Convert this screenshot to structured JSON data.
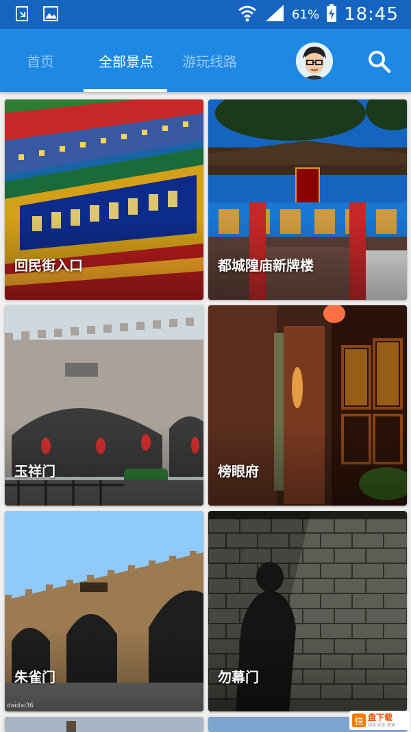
{
  "status_bar": {
    "battery_percent": "61%",
    "time": "18:45"
  },
  "tabs": [
    {
      "label": "首页",
      "active": false
    },
    {
      "label": "全部景点",
      "active": true
    },
    {
      "label": "游玩线路",
      "active": false
    }
  ],
  "attractions": [
    {
      "name": "回民街入口"
    },
    {
      "name": "都城隍庙新牌楼"
    },
    {
      "name": "玉祥门"
    },
    {
      "name": "榜眼府"
    },
    {
      "name": "朱雀门"
    },
    {
      "name": "勿幕门"
    }
  ],
  "photo_caption": "daidai36",
  "badge": {
    "mark": "快",
    "title": "盘下载",
    "subtitle": "绿色·安全·高速"
  },
  "colors": {
    "status_bar": "#1565c0",
    "app_bar": "#1e88e5"
  }
}
